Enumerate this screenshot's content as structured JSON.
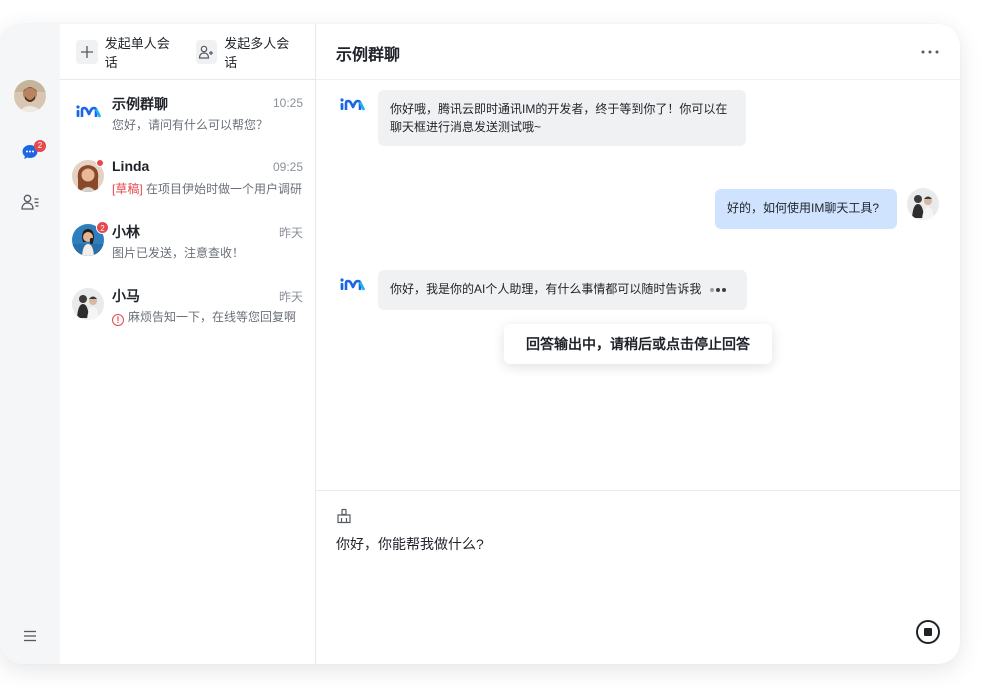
{
  "toolbar": {
    "new_single_chat": "发起单人会话",
    "new_group_chat": "发起多人会话"
  },
  "rail": {
    "chat_badge": "2",
    "icons": [
      "user-avatar",
      "chat-bubble-icon",
      "contacts-icon",
      "menu-icon"
    ]
  },
  "conversations": [
    {
      "name": "示例群聊",
      "time": "10:25",
      "preview": "您好，请问有什么可以帮您？",
      "avatar": "im-logo"
    },
    {
      "name": "Linda",
      "time": "09:25",
      "draft_label": "[草稿]",
      "preview": " 在项目伊始时做一个用户调研",
      "unread_dot": true
    },
    {
      "name": "小林",
      "time": "昨天",
      "preview": "图片已发送，注意查收！",
      "badge": "2"
    },
    {
      "name": "小马",
      "time": "昨天",
      "preview": "麻烦告知一下，在线等您回复啊",
      "warning": true
    }
  ],
  "chat": {
    "title": "示例群聊",
    "messages": [
      {
        "from": "bot",
        "text": "你好哦，腾讯云即时通讯IM的开发者，终于等到你了！你可以在聊天框进行消息发送测试哦~"
      },
      {
        "from": "me",
        "text": "好的，如何使用IM聊天工具?"
      },
      {
        "from": "bot",
        "text": "你好，我是你的AI个人助理，有什么事情都可以随时告诉我",
        "typing": true
      }
    ],
    "tooltip": "回答输出中，请稍后或点击停止回答",
    "composer_text": "你好，你能帮我做什么?"
  },
  "colors": {
    "accent": "#1c66e5",
    "badge": "#e5484d",
    "bubble_out": "#cfe3ff",
    "bubble_in": "#f0f1f3"
  }
}
